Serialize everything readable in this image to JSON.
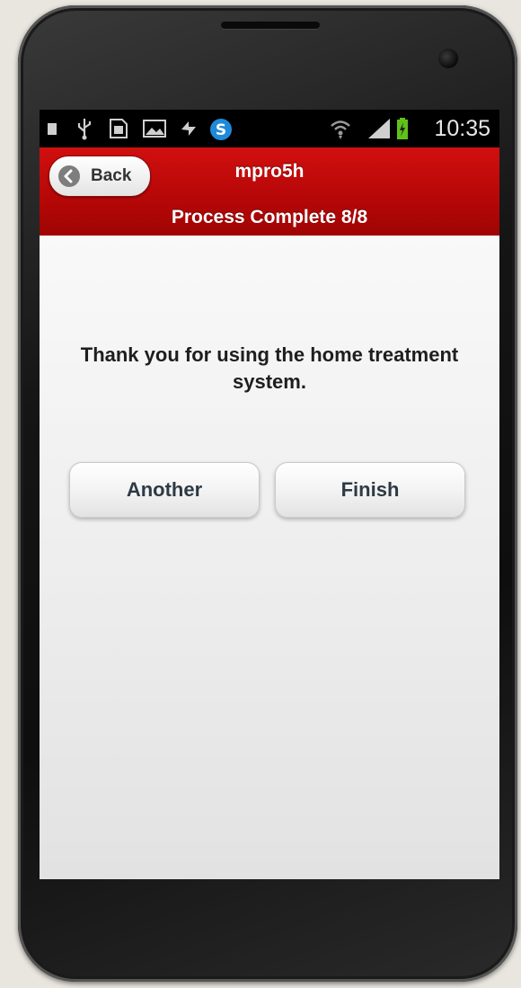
{
  "statusbar": {
    "time": "10:35",
    "icons": [
      "notification-icon",
      "usb-icon",
      "sd-card-icon",
      "image-icon",
      "sync-icon",
      "skype-icon",
      "wifi-icon",
      "signal-icon",
      "battery-charging-icon"
    ]
  },
  "header": {
    "back_label": "Back",
    "app_title": "mpro5h",
    "subtitle": "Process Complete 8/8"
  },
  "main": {
    "message": "Thank you for using the home treatment system.",
    "another_label": "Another",
    "finish_label": "Finish"
  },
  "colors": {
    "header_red": "#b50707",
    "button_text": "#2e3a44"
  }
}
